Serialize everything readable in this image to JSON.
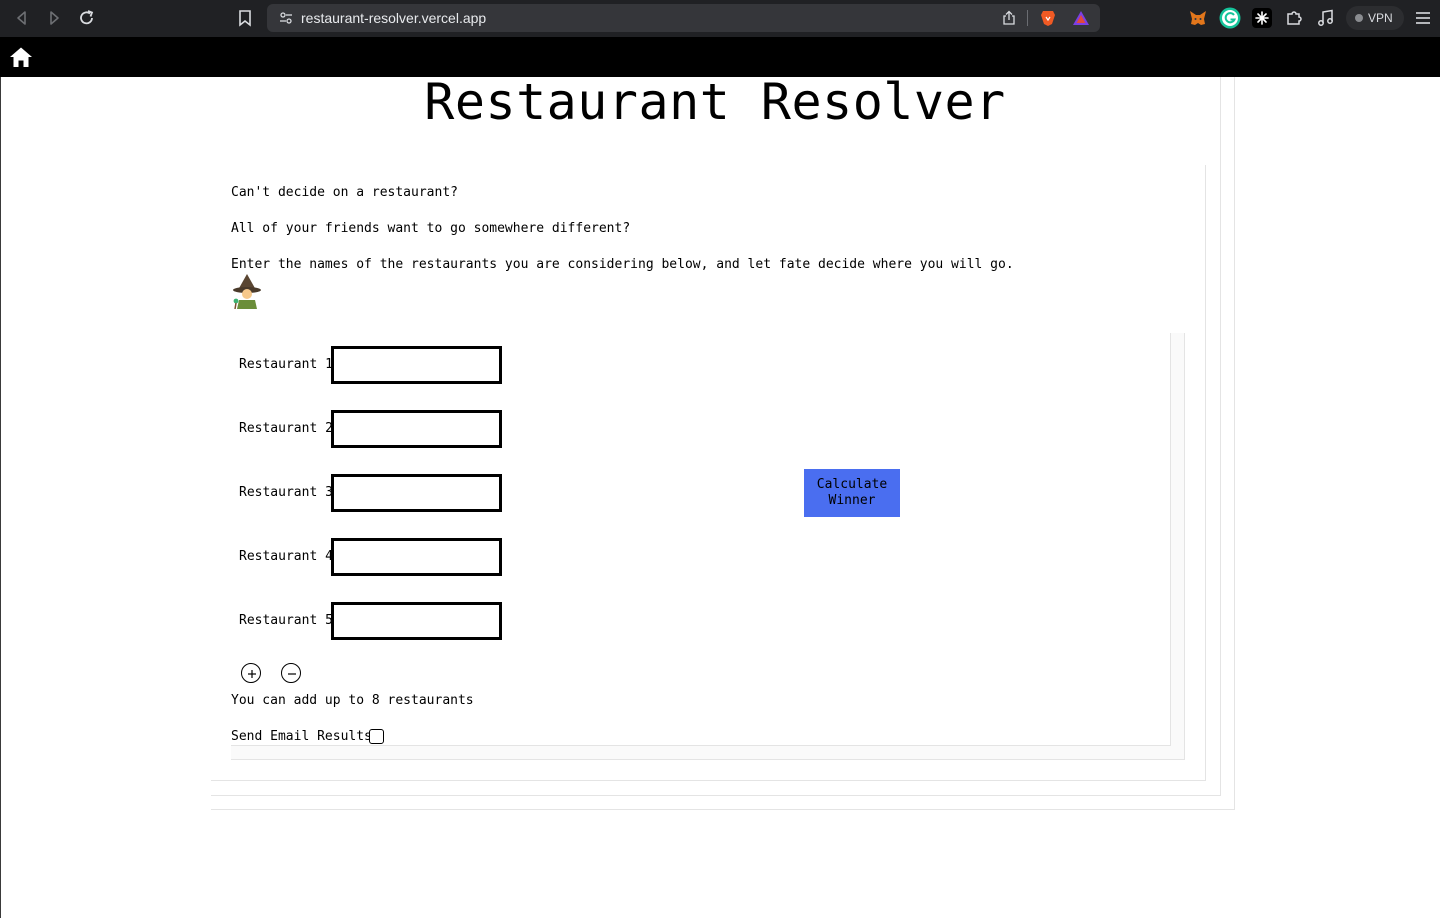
{
  "browser": {
    "url": "restaurant-resolver.vercel.app",
    "vpn_label": "VPN",
    "icons": [
      "back-icon",
      "forward-icon",
      "reload-icon",
      "bookmark-icon",
      "site-settings-icon",
      "share-icon",
      "brave-shields-icon",
      "brave-rewards-icon",
      "metamask-icon",
      "grammarly-icon",
      "extension-icon",
      "extensions-puzzle-icon",
      "media-icon",
      "menu-icon"
    ]
  },
  "app_bar": {
    "icon": "home-icon"
  },
  "page": {
    "title": "Restaurant Resolver",
    "intro": [
      "Can't decide on a restaurant?",
      "All of your friends want to go somewhere different?",
      "Enter the names of the restaurants you are considering below, and let fate decide where you will go."
    ],
    "mascot_icon": "wizard-emoji-icon"
  },
  "form": {
    "restaurants": [
      {
        "label": "Restaurant 1",
        "value": ""
      },
      {
        "label": "Restaurant 2",
        "value": ""
      },
      {
        "label": "Restaurant 3",
        "value": ""
      },
      {
        "label": "Restaurant 4",
        "value": ""
      },
      {
        "label": "Restaurant 5",
        "value": ""
      }
    ],
    "calculate_label": "Calculate\nWinner",
    "add_icon": "plus-circle-icon",
    "remove_icon": "minus-circle-icon",
    "limit_note": "You can add up to 8 restaurants",
    "email_label": "Send Email Results",
    "email_checked": false
  },
  "colors": {
    "calculate_button": "#4a6ef0",
    "app_bar": "#000000",
    "browser_chrome": "#202124"
  }
}
